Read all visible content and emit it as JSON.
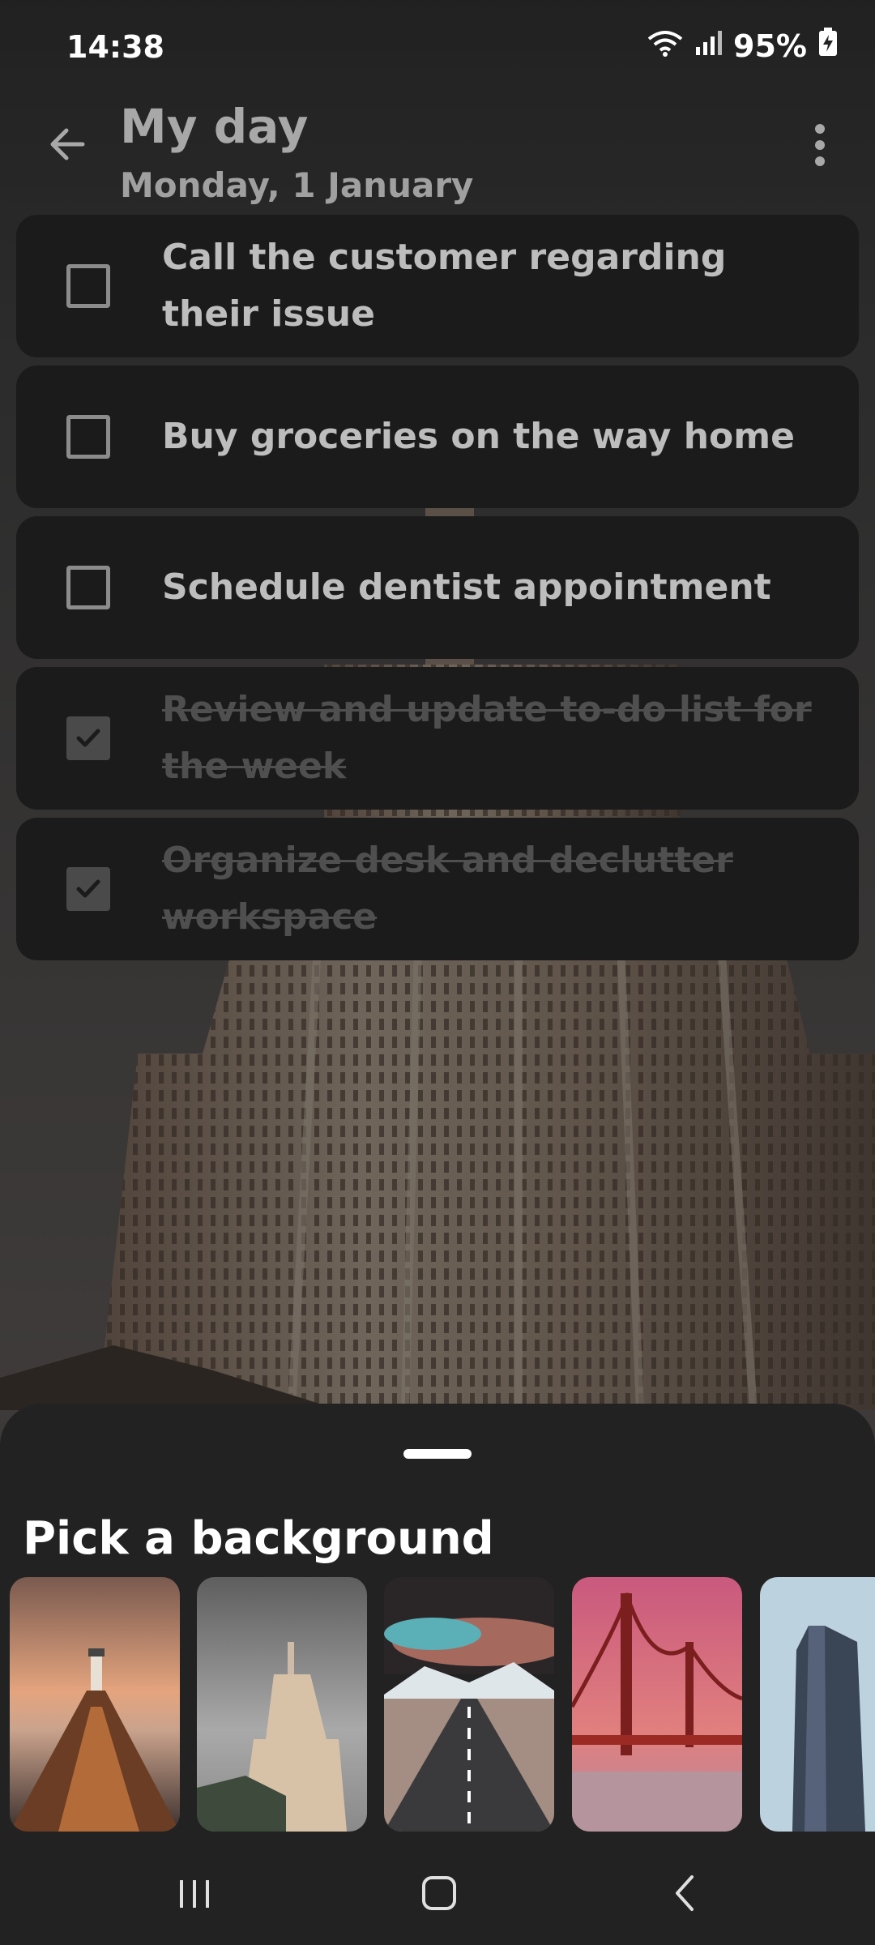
{
  "status": {
    "time": "14:38",
    "battery": "95%",
    "icons": [
      "wifi-icon",
      "signal-icon",
      "battery-charging-icon"
    ]
  },
  "header": {
    "title": "My day",
    "date": "Monday, 1 January",
    "icons": [
      "back-arrow-icon",
      "more-vert-icon"
    ]
  },
  "tasks": [
    {
      "text": "Call the customer regarding their issue",
      "done": false
    },
    {
      "text": "Buy groceries on the way home",
      "done": false
    },
    {
      "text": "Schedule dentist appointment",
      "done": false
    },
    {
      "text": "Review and update to-do list for the week",
      "done": true
    },
    {
      "text": "Organize desk and declutter workspace",
      "done": true
    }
  ],
  "sheet": {
    "title": "Pick a background",
    "backgrounds": [
      {
        "name": "lighthouse-pier"
      },
      {
        "name": "empire-state-building"
      },
      {
        "name": "mountain-road"
      },
      {
        "name": "golden-gate-bridge"
      },
      {
        "name": "flatiron-building"
      }
    ]
  },
  "navbar": {
    "icons": [
      "recent-apps-icon",
      "home-icon",
      "back-icon"
    ]
  }
}
